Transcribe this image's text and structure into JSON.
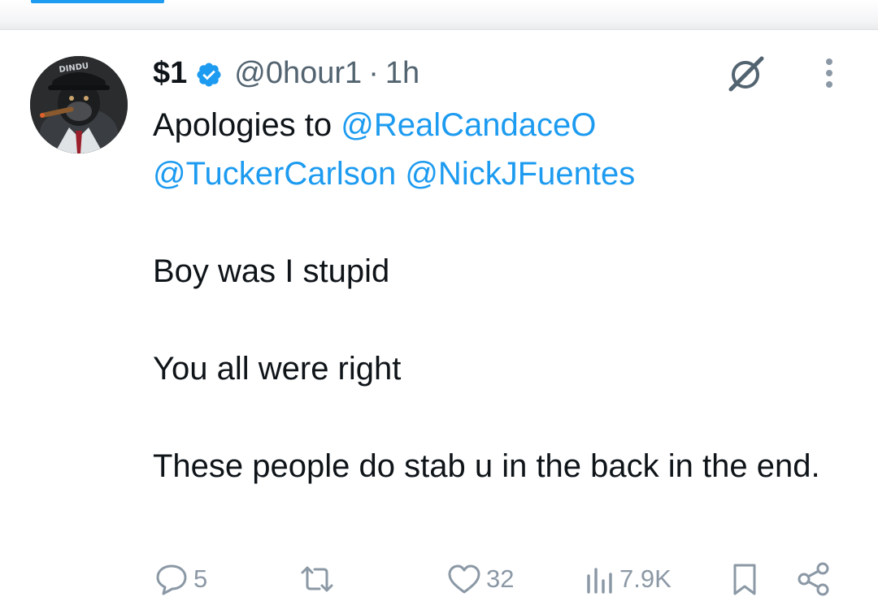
{
  "colors": {
    "accent": "#1d9bf0",
    "text": "#0f1419",
    "secondary": "#536471",
    "action_gray": "#8b98a5"
  },
  "tweet": {
    "author": {
      "display_name": "$1",
      "handle": "@0hour1",
      "separator": "·",
      "time": "1h",
      "verified": true,
      "avatar_label": "DINDU"
    },
    "text": {
      "line1_prefix": "Apologies to ",
      "mention1": "@RealCandaceO",
      "mention2": "@TuckerCarlson",
      "mention3": "@NickJFuentes",
      "para2": "Boy was I stupid",
      "para3": "You all were right",
      "para4": "These people do stab u in the back in the end."
    },
    "actions": {
      "reply_count": "5",
      "retweet_count": "",
      "like_count": "32",
      "views_count": "7.9K"
    }
  }
}
